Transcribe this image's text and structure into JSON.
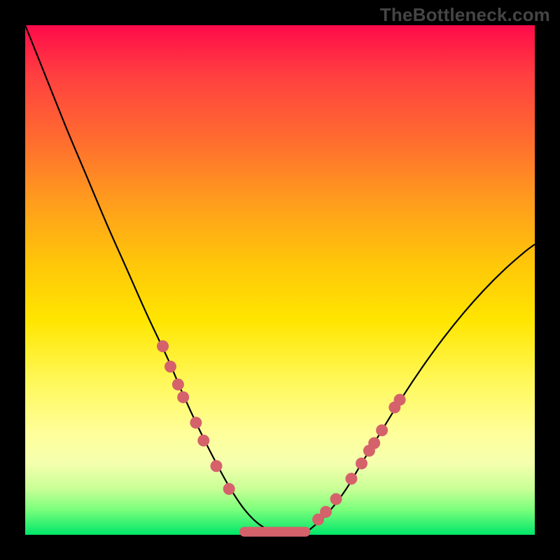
{
  "watermark": "TheBottleneck.com",
  "chart_data": {
    "type": "line",
    "title": "",
    "xlabel": "",
    "ylabel": "",
    "xlim": [
      0,
      100
    ],
    "ylim": [
      0,
      100
    ],
    "grid": false,
    "legend": false,
    "background": "rainbow-gradient-red-to-green",
    "series": [
      {
        "name": "curve",
        "x": [
          0,
          4,
          8,
          12,
          16,
          20,
          24,
          28,
          31,
          34,
          37,
          40,
          43,
          46,
          50,
          54,
          57,
          60,
          63,
          66,
          70,
          74,
          78,
          82,
          86,
          90,
          94,
          98,
          100
        ],
        "y": [
          100,
          90,
          80,
          70.5,
          61,
          52,
          43,
          34.5,
          27.5,
          21,
          15,
          9.5,
          5,
          2,
          0,
          0,
          2,
          5,
          9,
          14,
          20.5,
          27,
          33,
          38.5,
          43.5,
          48,
          52,
          55.5,
          57
        ]
      }
    ],
    "markers": {
      "name": "sample-points",
      "color": "#d5626b",
      "points": [
        {
          "x": 27,
          "y": 37
        },
        {
          "x": 28.5,
          "y": 33
        },
        {
          "x": 30,
          "y": 29.5
        },
        {
          "x": 31,
          "y": 27
        },
        {
          "x": 33.5,
          "y": 22
        },
        {
          "x": 35,
          "y": 18.5
        },
        {
          "x": 37.5,
          "y": 13.5
        },
        {
          "x": 40,
          "y": 9
        },
        {
          "x": 57.5,
          "y": 3
        },
        {
          "x": 59,
          "y": 4.5
        },
        {
          "x": 61,
          "y": 7
        },
        {
          "x": 64,
          "y": 11
        },
        {
          "x": 66,
          "y": 14
        },
        {
          "x": 67.5,
          "y": 16.5
        },
        {
          "x": 68.5,
          "y": 18
        },
        {
          "x": 70,
          "y": 20.5
        },
        {
          "x": 72.5,
          "y": 25
        },
        {
          "x": 73.5,
          "y": 26.5
        }
      ],
      "track": {
        "x0": 43,
        "x1": 55,
        "y": 0.6
      }
    }
  }
}
